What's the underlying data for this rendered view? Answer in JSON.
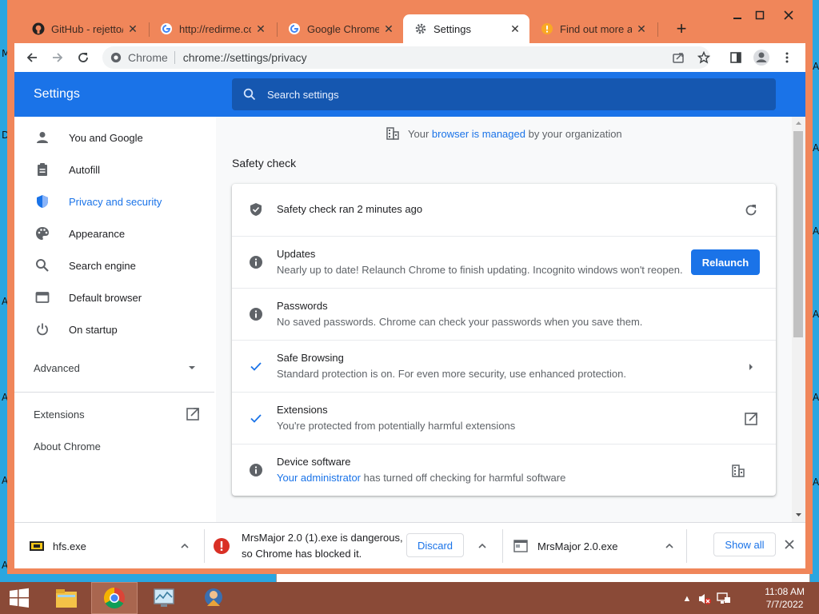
{
  "desktop": {
    "left_letters": [
      "M",
      "D",
      "A",
      "A",
      "A",
      "A"
    ],
    "right_letters": [
      "A",
      "A",
      "A",
      "A",
      "A",
      "A"
    ]
  },
  "tabs": [
    {
      "title": "GitHub - rejetto/h",
      "icon": "github-icon"
    },
    {
      "title": "http://redirme.co",
      "icon": "google-icon"
    },
    {
      "title": "Google Chrome b",
      "icon": "google-icon"
    },
    {
      "title": "Settings",
      "icon": "gear-icon"
    },
    {
      "title": "Find out more ab",
      "icon": "warning-icon"
    }
  ],
  "omnibox": {
    "site": "Chrome",
    "url": "chrome://settings/privacy"
  },
  "settings": {
    "title": "Settings",
    "search_placeholder": "Search settings"
  },
  "sidebar": {
    "items": [
      {
        "label": "You and Google",
        "icon": "person-icon"
      },
      {
        "label": "Autofill",
        "icon": "clipboard-icon"
      },
      {
        "label": "Privacy and security",
        "icon": "shield-icon"
      },
      {
        "label": "Appearance",
        "icon": "palette-icon"
      },
      {
        "label": "Search engine",
        "icon": "search-icon"
      },
      {
        "label": "Default browser",
        "icon": "browser-icon"
      },
      {
        "label": "On startup",
        "icon": "power-icon"
      }
    ],
    "advanced": "Advanced",
    "extensions": "Extensions",
    "about": "About Chrome"
  },
  "managed": {
    "prefix": "Your",
    "link": "browser is managed",
    "suffix": "by your organization"
  },
  "safety": {
    "section_title": "Safety check",
    "header": "Safety check ran 2 minutes ago",
    "rows": [
      {
        "title": "Updates",
        "subtitle": "Nearly up to date! Relaunch Chrome to finish updating. Incognito windows won't reopen."
      },
      {
        "title": "Passwords",
        "subtitle": "No saved passwords. Chrome can check your passwords when you save them."
      },
      {
        "title": "Safe Browsing",
        "subtitle": "Standard protection is on. For even more security, use enhanced protection."
      },
      {
        "title": "Extensions",
        "subtitle": "You're protected from potentially harmful extensions"
      },
      {
        "title": "Device software",
        "subtitle_link": "Your administrator",
        "subtitle": " has turned off checking for harmful software"
      }
    ],
    "relaunch_label": "Relaunch"
  },
  "downloads": {
    "item1": "hfs.exe",
    "item2_line1": "MrsMajor 2.0 (1).exe is dangerous,",
    "item2_line2": "so Chrome has blocked it.",
    "discard": "Discard",
    "item3": "MrsMajor 2.0.exe",
    "show_all": "Show all"
  },
  "clock": {
    "time": "11:08 AM",
    "date": "7/7/2022"
  },
  "colors": {
    "accent": "#1a73e8",
    "tabstrip": "#f0865a",
    "taskbar": "#8a4a37"
  }
}
